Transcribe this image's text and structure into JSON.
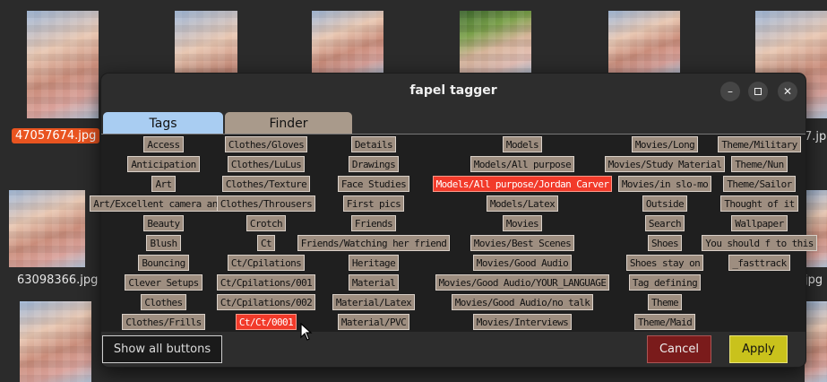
{
  "window": {
    "title": "fapel tagger"
  },
  "background": {
    "file_labels": [
      "47057674.jpg",
      "7.jp",
      "63098366.jpg",
      "jpg"
    ]
  },
  "tabs": [
    {
      "label": "Tags",
      "active": true
    },
    {
      "label": "Finder",
      "active": false
    }
  ],
  "tag_columns": [
    [
      "Access",
      "Anticipation",
      "Art",
      "Art/Excellent camera angle",
      "Beauty",
      "Blush",
      "Bouncing",
      "Clever Setups",
      "Clothes",
      "Clothes/Frills"
    ],
    [
      "Clothes/Gloves",
      "Clothes/LuLus",
      "Clothes/Texture",
      "Clothes/Throusers",
      "Crotch",
      "Ct",
      "Ct/Cpilations",
      "Ct/Cpilations/001",
      "Ct/Cpilations/002",
      "Ct/Ct/0001"
    ],
    [
      "Details",
      "Drawings",
      "Face Studies",
      "First pics",
      "Friends",
      "Friends/Watching her friend",
      "Heritage",
      "Material",
      "Material/Latex",
      "Material/PVC"
    ],
    [
      "Models",
      "Models/All purpose",
      "Models/All purpose/Jordan Carver",
      "Models/Latex",
      "Movies",
      "Movies/Best Scenes",
      "Movies/Good Audio",
      "Movies/Good Audio/YOUR_LANGUAGE",
      "Movies/Good Audio/no talk",
      "Movies/Interviews"
    ],
    [
      "Movies/Long",
      "Movies/Study Material",
      "Movies/in slo-mo",
      "Outside",
      "Search",
      "Shoes",
      "Shoes stay on",
      "Tag defining",
      "Theme",
      "Theme/Maid"
    ],
    [
      "Theme/Military",
      "Theme/Nun",
      "Theme/Sailor",
      "Thought of it",
      "Wallpaper",
      "You should f to this",
      "_fasttrack"
    ]
  ],
  "active_tags": [
    "Models/All purpose/Jordan Carver",
    "Ct/Ct/0001"
  ],
  "buttons": {
    "show_all": "Show all buttons",
    "cancel": "Cancel",
    "apply": "Apply"
  },
  "colors": {
    "tag_bg": "#9e8e80",
    "tag_active": "#f23a2a",
    "tab_active": "#a9cdf2",
    "cancel_bg": "#7a1b1b",
    "apply_bg": "#c9c21c",
    "selection": "#e95420"
  }
}
